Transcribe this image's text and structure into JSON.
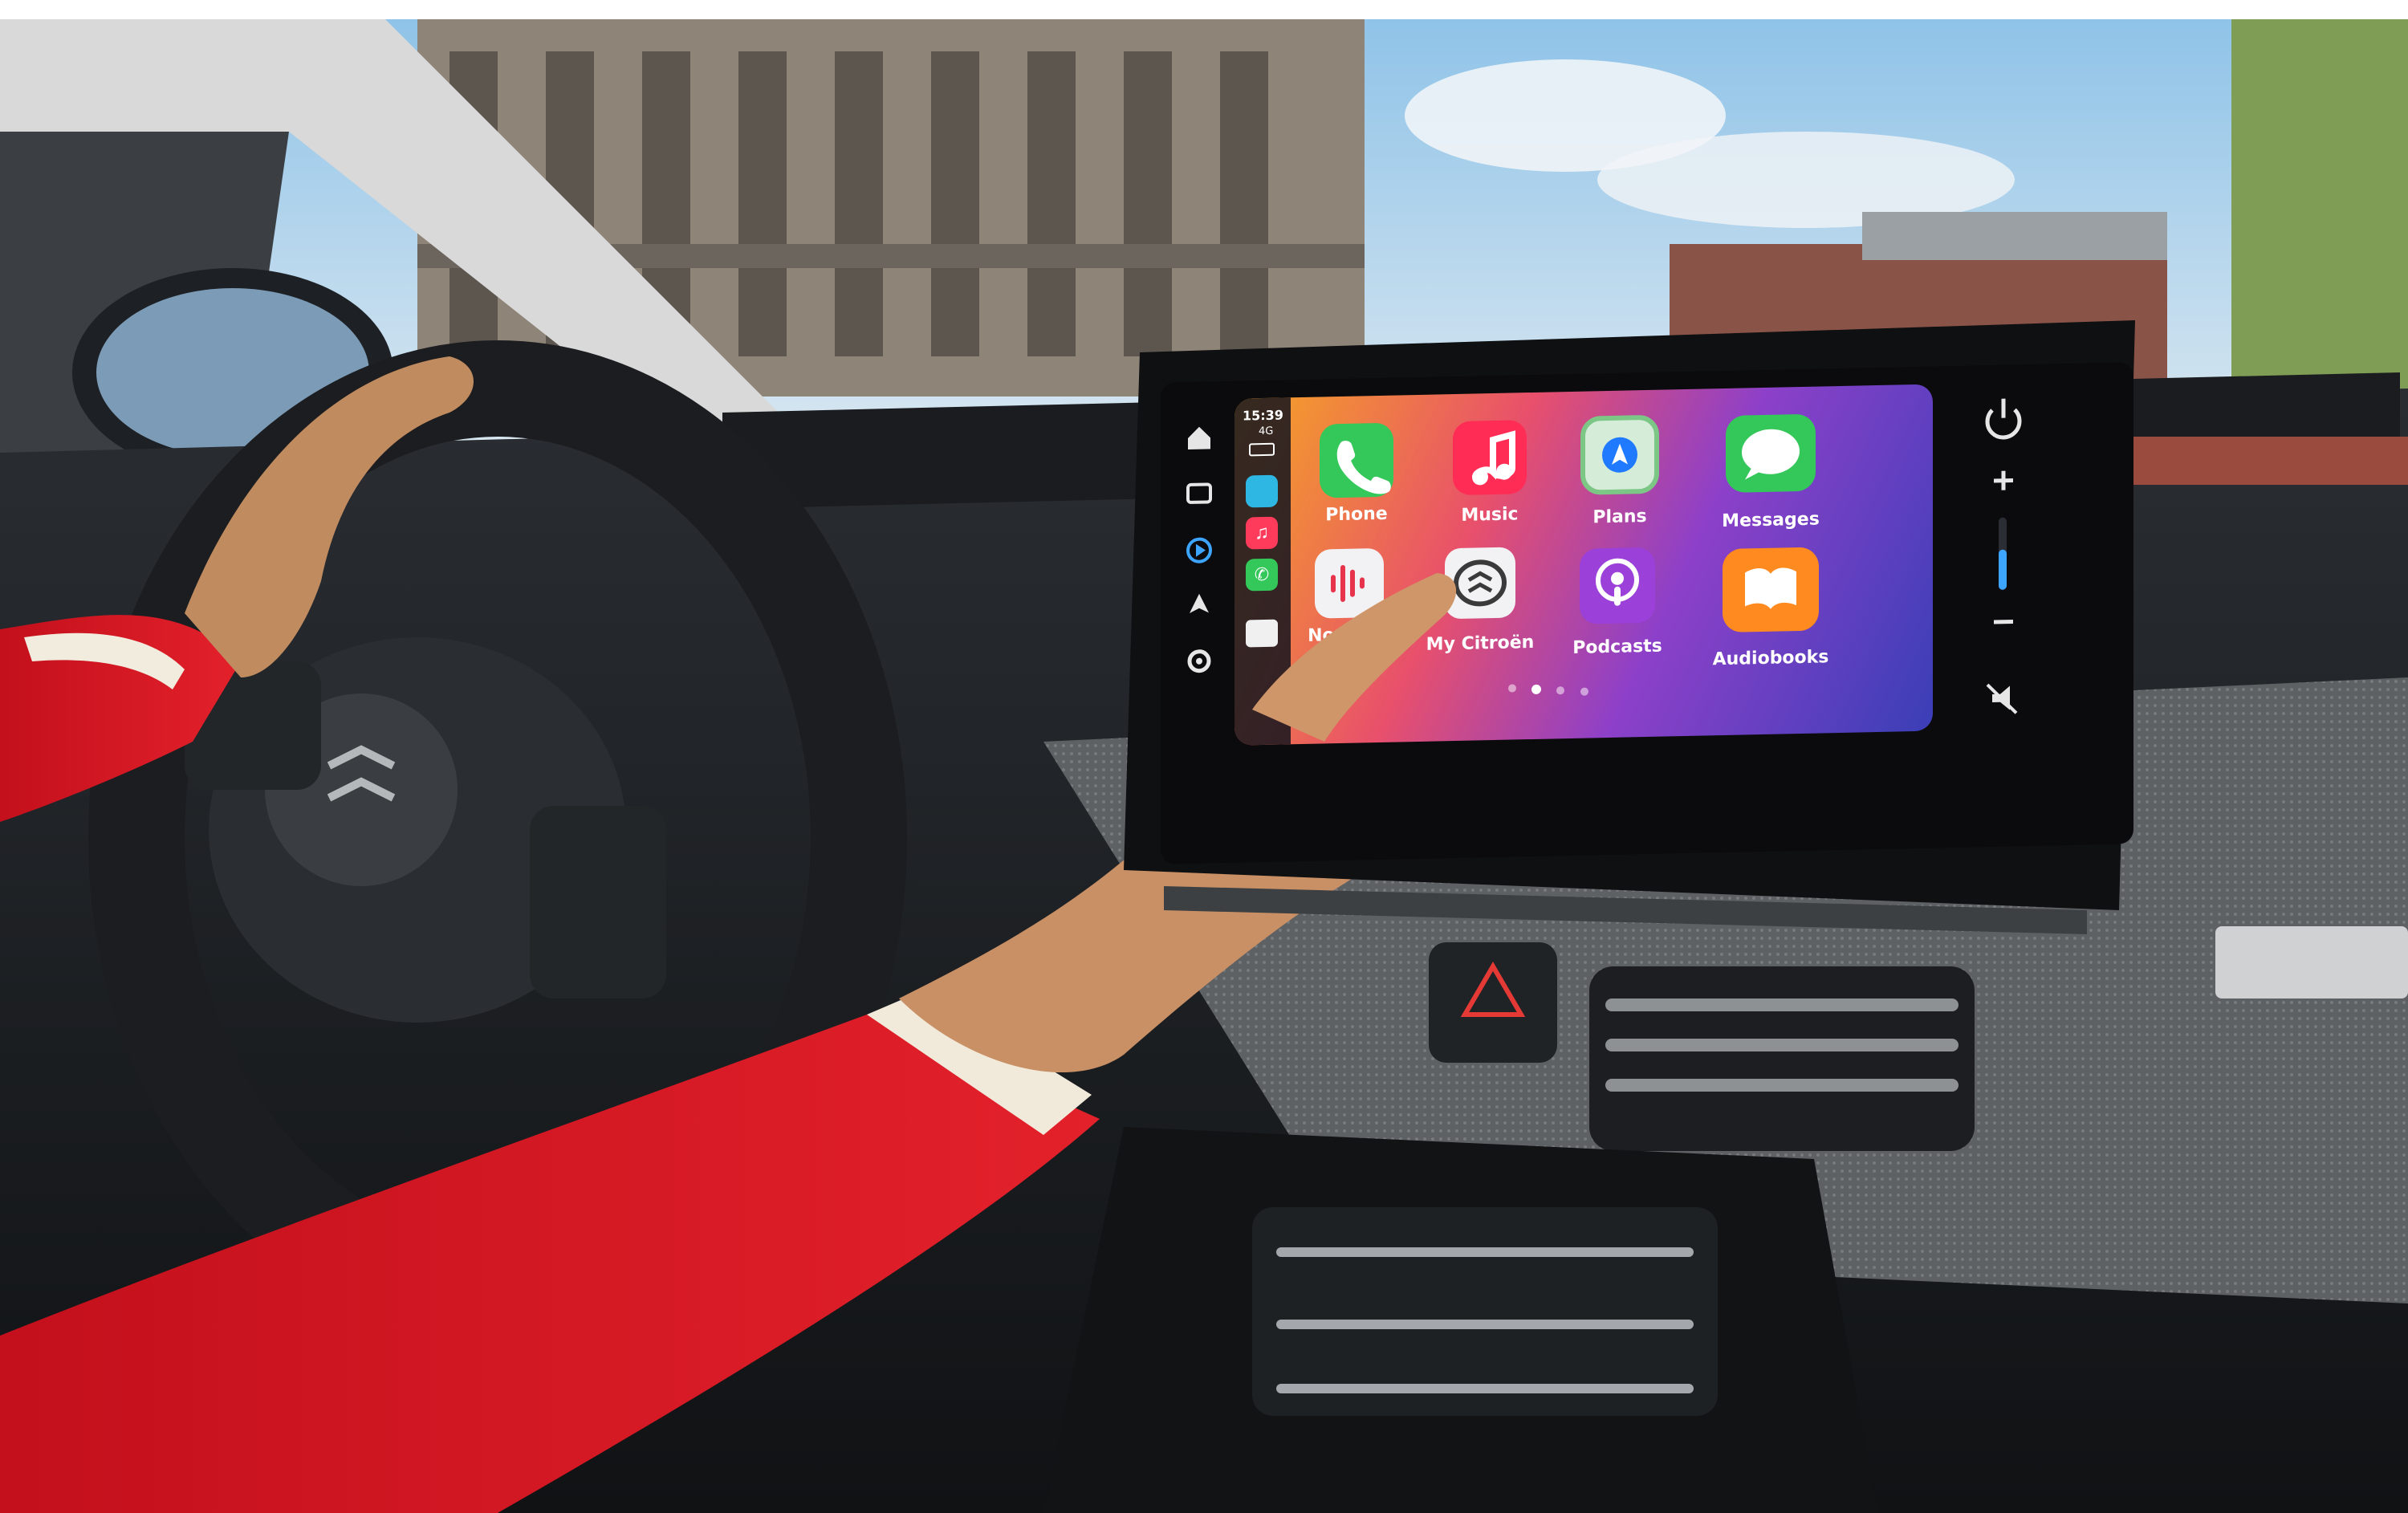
{
  "status_bar": {
    "time": "15:39",
    "network": "4G"
  },
  "apps": [
    {
      "label": "Phone",
      "icon": "phone-icon"
    },
    {
      "label": "Music",
      "icon": "music-icon"
    },
    {
      "label": "Plans",
      "icon": "maps-icon"
    },
    {
      "label": "Messages",
      "icon": "messages-icon"
    },
    {
      "label": "Now",
      "icon": "now-playing-icon"
    },
    {
      "label": "My Citroën",
      "icon": "citroen-icon"
    },
    {
      "label": "Podcasts",
      "icon": "podcasts-icon"
    },
    {
      "label": "Audiobooks",
      "icon": "audiobooks-icon"
    }
  ],
  "pager": {
    "page_count": 4,
    "current_page": 1
  },
  "side_rail": {
    "left": [
      "home-icon",
      "car-mode-icon",
      "media-source-icon",
      "navigation-arrow-icon",
      "settings-gear-icon"
    ],
    "right": [
      "power-icon",
      "volume-up-icon",
      "volume-down-icon",
      "mute-icon"
    ]
  },
  "colors": {
    "wallpaper_start": "#f5a623",
    "wallpaper_mid": "#e8506b",
    "wallpaper_end": "#3a3fb7",
    "accent_blue": "#3da5ff"
  }
}
